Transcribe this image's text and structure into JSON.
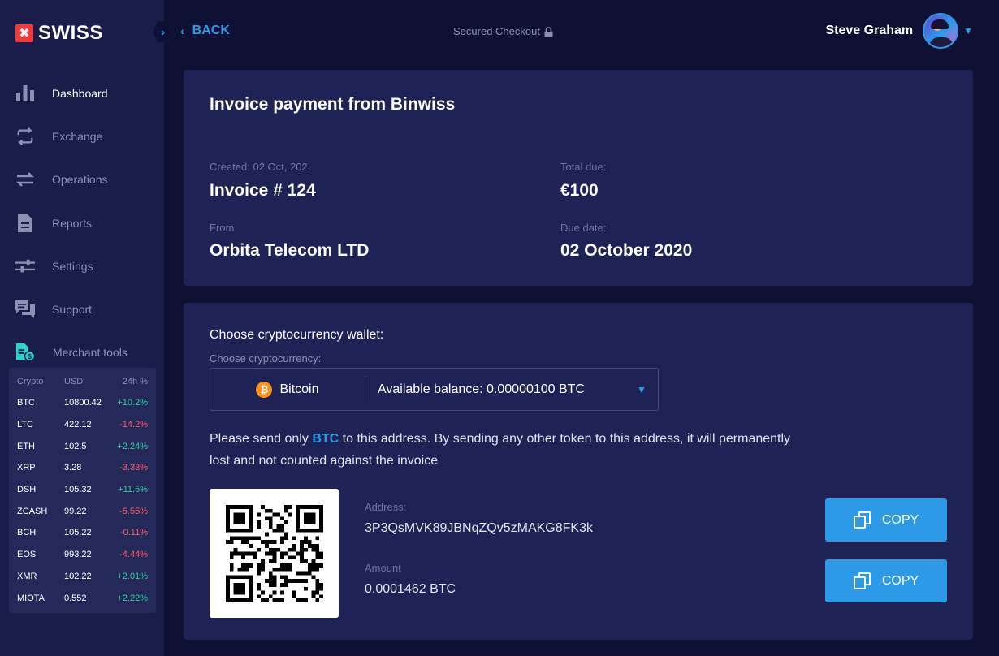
{
  "brand": {
    "mark": "✖",
    "name": "SWISS"
  },
  "sidebar": {
    "items": [
      {
        "label": "Dashboard",
        "icon": "bar-chart-icon"
      },
      {
        "label": "Exchange",
        "icon": "exchange-icon"
      },
      {
        "label": "Operations",
        "icon": "transfer-arrows-icon"
      },
      {
        "label": "Reports",
        "icon": "document-icon"
      },
      {
        "label": "Settings",
        "icon": "sliders-icon"
      },
      {
        "label": "Support",
        "icon": "chat-icon"
      },
      {
        "label": "Merchant tools",
        "icon": "merchant-doc-icon"
      }
    ],
    "active": "Dashboard"
  },
  "ticker": {
    "headers": [
      "Crypto",
      "USD",
      "24h %"
    ],
    "rows": [
      {
        "coin": "BTC",
        "usd": "10800.42",
        "change": "+10.2%",
        "trend": "up"
      },
      {
        "coin": "LTC",
        "usd": "422.12",
        "change": "-14.2%",
        "trend": "down"
      },
      {
        "coin": "ETH",
        "usd": "102.5",
        "change": "+2.24%",
        "trend": "up"
      },
      {
        "coin": "XRP",
        "usd": "3.28",
        "change": "-3.33%",
        "trend": "down"
      },
      {
        "coin": "DSH",
        "usd": "105.32",
        "change": "+11.5%",
        "trend": "up"
      },
      {
        "coin": "ZCASH",
        "usd": "99.22",
        "change": "-5.55%",
        "trend": "down"
      },
      {
        "coin": "BCH",
        "usd": "105.22",
        "change": "-0.11%",
        "trend": "down"
      },
      {
        "coin": "EOS",
        "usd": "993.22",
        "change": "-4.44%",
        "trend": "down"
      },
      {
        "coin": "XMR",
        "usd": "102.22",
        "change": "+2.01%",
        "trend": "up"
      },
      {
        "coin": "MIOTA",
        "usd": "0.552",
        "change": "+2.22%",
        "trend": "up"
      }
    ]
  },
  "header": {
    "back_label": "BACK",
    "secured_label": "Secured Checkout",
    "user_name": "Steve Graham"
  },
  "invoice": {
    "title": "Invoice payment from Binwiss",
    "created_label": "Created: 02 Oct, 202",
    "number": "Invoice # 124",
    "total_label": "Total due:",
    "total": "€100",
    "from_label": "From",
    "from": "Orbita Telecom LTD",
    "due_label": "Due date:",
    "due": "02 October 2020"
  },
  "wallet": {
    "title": "Choose cryptocurrency wallet:",
    "sub": "Choose cryptocurrency:",
    "coin_symbol": "₿",
    "coin": "Bitcoin",
    "balance": "Available balance: 0.00000100 BTC",
    "notice_pre": "Please send only ",
    "notice_token": "BTC",
    "notice_post": " to this address. By sending any other token to this address, it will permanently lost and not counted against the invoice",
    "address_label": "Address:",
    "address": "3P3QsMVK89JBNqZQv5zMAKG8FK3k",
    "amount_label": "Amount",
    "amount": "0.0001462 BTC",
    "copy_label": "COPY"
  },
  "colors": {
    "accent": "#2d9ae8",
    "positive": "#2ed19d",
    "negative": "#ff5b6e",
    "sidebar_bg": "#1a1d4a",
    "page_bg": "#0e1133",
    "card_bg": "#1f2255",
    "brand_red": "#ee3b3b",
    "bitcoin_orange": "#f7931a"
  }
}
